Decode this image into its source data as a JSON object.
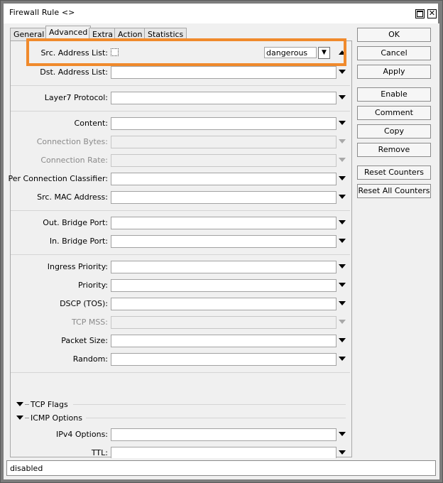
{
  "window": {
    "title": "Firewall Rule <>",
    "maximize_icon": "maximize-icon",
    "close_icon": "close-icon",
    "close_glyph": "✕"
  },
  "tabs": [
    {
      "label": "General",
      "active": false
    },
    {
      "label": "Advanced",
      "active": true
    },
    {
      "label": "Extra",
      "active": false
    },
    {
      "label": "Action",
      "active": false
    },
    {
      "label": "Statistics",
      "active": false
    }
  ],
  "fields": {
    "src_address_list": {
      "label": "Src. Address List:",
      "value": "dangerous",
      "negated": false
    },
    "dst_address_list": {
      "label": "Dst. Address List:"
    },
    "layer7_protocol": {
      "label": "Layer7 Protocol:"
    },
    "content": {
      "label": "Content:"
    },
    "connection_bytes": {
      "label": "Connection Bytes:",
      "disabled": true
    },
    "connection_rate": {
      "label": "Connection Rate:",
      "disabled": true
    },
    "per_connection_classifier": {
      "label": "Per Connection Classifier:"
    },
    "src_mac_address": {
      "label": "Src. MAC Address:"
    },
    "out_bridge_port": {
      "label": "Out. Bridge Port:"
    },
    "in_bridge_port": {
      "label": "In. Bridge Port:"
    },
    "ingress_priority": {
      "label": "Ingress Priority:"
    },
    "priority": {
      "label": "Priority:"
    },
    "dscp_tos": {
      "label": "DSCP (TOS):"
    },
    "tcp_mss": {
      "label": "TCP MSS:",
      "disabled": true
    },
    "packet_size": {
      "label": "Packet Size:"
    },
    "random": {
      "label": "Random:"
    },
    "ipv4_options": {
      "label": "IPv4 Options:"
    },
    "ttl": {
      "label": "TTL:"
    }
  },
  "sections": {
    "tcp_flags": "TCP Flags",
    "icmp_options": "ICMP Options"
  },
  "buttons": {
    "ok": "OK",
    "cancel": "Cancel",
    "apply": "Apply",
    "enable": "Enable",
    "comment": "Comment",
    "copy": "Copy",
    "remove": "Remove",
    "reset_counters": "Reset Counters",
    "reset_all_counters": "Reset All Counters"
  },
  "status": {
    "text": "disabled"
  },
  "highlight_color": "#f08a2c"
}
